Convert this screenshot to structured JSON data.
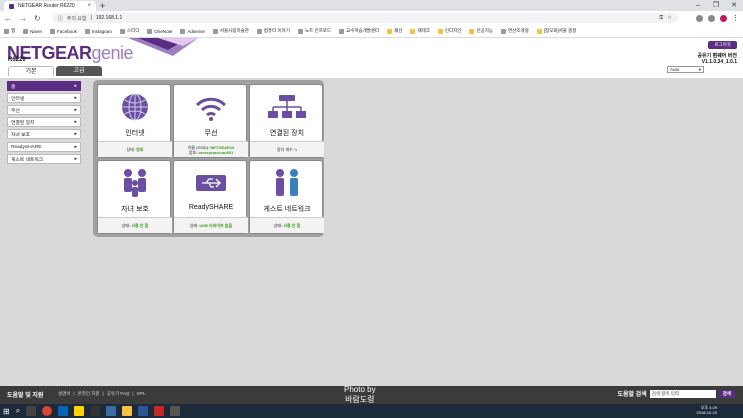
{
  "browser": {
    "tab_title": "NETGEAR Router R6220",
    "new_tab_symbol": "+",
    "close_symbol": "×",
    "insecure_label": "주의 요함",
    "url": "192.168.1.1",
    "bookmarks": [
      {
        "label": "앱",
        "folder": false
      },
      {
        "label": "Naver",
        "folder": false
      },
      {
        "label": "Facebook",
        "folder": false
      },
      {
        "label": "Instagram",
        "folder": false
      },
      {
        "label": "스티디",
        "folder": false
      },
      {
        "label": "OneNote",
        "folder": false
      },
      {
        "label": "Adsense",
        "folder": false
      },
      {
        "label": "서울시립미술관",
        "folder": false
      },
      {
        "label": "컴퓨터 이야기",
        "folder": false
      },
      {
        "label": "노트 인프로드",
        "folder": false
      },
      {
        "label": "교수학습개발센터",
        "folder": false
      },
      {
        "label": "패션",
        "folder": true
      },
      {
        "label": "재테크",
        "folder": true
      },
      {
        "label": "인디지인",
        "folder": true
      },
      {
        "label": "인공지능",
        "folder": true
      },
      {
        "label": "연산조개형",
        "folder": false
      },
      {
        "label": "[정모회]서울 충청",
        "folder": true
      }
    ]
  },
  "header": {
    "logo_brand": "NETGEAR",
    "logo_genie": "genie",
    "model": "R6220",
    "logout_label": "로그아웃",
    "firmware_label": "공유기 펌웨어 버전",
    "firmware_version": "V1.1.0.34_1.0.1",
    "language": "Auto",
    "tab_basic": "기본",
    "tab_advanced": "고급"
  },
  "sidebar": {
    "items": [
      {
        "label": "홈",
        "active": true
      },
      {
        "label": "인터넷",
        "active": false
      },
      {
        "label": "무선",
        "active": false
      },
      {
        "label": "연결된 장치",
        "active": false
      },
      {
        "label": "자녀 보호",
        "active": false
      },
      {
        "label": "ReadySHARE",
        "active": false
      },
      {
        "label": "게스트 네트워크",
        "active": false
      }
    ]
  },
  "dashboard": {
    "internet": {
      "name": "인터넷",
      "status_label": "상태:",
      "status_value": "양호"
    },
    "wireless": {
      "name": "무선",
      "ssid_label": "이름 (SSID):",
      "ssid_value": "NETGEAR10",
      "key_label": "암호:",
      "key_value": "breezyraccoon801"
    },
    "devices": {
      "name": "연결된 장치",
      "count_label": "장치 개수:",
      "count_value": "1"
    },
    "parental": {
      "name": "자녀 보호",
      "status_label": "상태:",
      "status_value": "사용 안 함"
    },
    "readyshare": {
      "name": "ReadySHARE",
      "status_label": "상태:",
      "status_value": "USB 드라이브 없음"
    },
    "guest": {
      "name": "게스트 네트워크",
      "status_label": "상태:",
      "status_value": "사용 안 함"
    }
  },
  "footer": {
    "help_title": "도움말 및 지원",
    "links": [
      "설명서",
      "|",
      "온라인 지원",
      "|",
      "공유기 FAQ",
      "|",
      "GPL"
    ],
    "search_title": "도움말 검색",
    "search_placeholder": "검색 항목 입력",
    "search_button": "검색"
  },
  "watermark": {
    "line1": "Photo by",
    "line2": "바람도령"
  },
  "taskbar": {
    "time": "오후 4:29",
    "date": "2018-10-23"
  },
  "colors": {
    "brand": "#5a2d82",
    "status_ok": "#3c9a1b"
  }
}
